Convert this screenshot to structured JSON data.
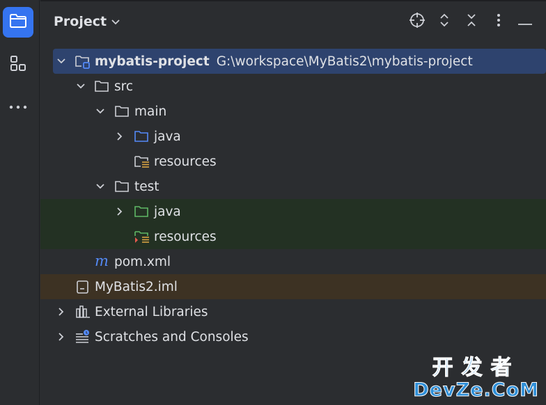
{
  "panel": {
    "title": "Project"
  },
  "toolstrip": {
    "icons": [
      "folder-icon",
      "structure-icon",
      "more-icon"
    ]
  },
  "header_actions": [
    "locate-icon",
    "expand-collapse-icon",
    "collapse-all-icon",
    "options-icon",
    "minimize-icon"
  ],
  "tree": {
    "root_label": "mybatis-project",
    "root_path": "G:\\workspace\\MyBatis2\\mybatis-project",
    "src": "src",
    "main": "main",
    "main_java": "java",
    "main_resources": "resources",
    "test": "test",
    "test_java": "java",
    "test_resources": "resources",
    "pom": "pom.xml",
    "iml": "MyBatis2.iml",
    "external": "External Libraries",
    "scratches": "Scratches and Consoles"
  },
  "watermark": {
    "top": "开发者",
    "bottom": "DevZe.CoM"
  },
  "colors": {
    "accent": "#3574f0",
    "selection": "#2e436e",
    "test_bg": "#233123",
    "excluded_bg": "#3d3223",
    "source_folder": "#548af7",
    "test_folder": "#5fb865"
  }
}
